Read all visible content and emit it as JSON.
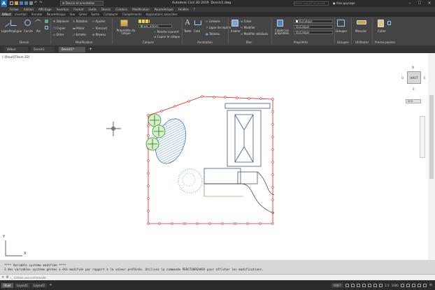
{
  "title": {
    "app": "Autodesk Civil 3D 2019",
    "file": "Dessin1.dwg",
    "workspace": "Dessin et annotation",
    "search_placeholder": "Entrez mot-clé ou phrase",
    "user": "Alex.gaysage"
  },
  "menu": [
    "Fichier",
    "Edition",
    "Affichage",
    "Insertion",
    "Format",
    "Outils",
    "Dessin",
    "Cotation",
    "Modification",
    "Paramétrique",
    "Fenêtre",
    "?"
  ],
  "ribbon_tabs": [
    "Début",
    "Insertion",
    "Annoter",
    "Paramétrique",
    "Vue",
    "Gérer",
    "Sortie",
    "Collaborer",
    "Compléments",
    "Applications associées"
  ],
  "ribbon": {
    "groups": [
      "Dessin",
      "Modification",
      "Calques",
      "Annotation",
      "Bloc",
      "Propriétés",
      "Groupes",
      "Utilitaires",
      "Presse-papiers"
    ],
    "draw_tools": [
      "Ligne",
      "Polyligne",
      "Cercle",
      "Arc"
    ],
    "modify_tools": [
      "Déplacer",
      "Rotation",
      "Ajuster",
      "Copier",
      "Miroir",
      "Raccord",
      "Etirer",
      "Echelle",
      "Réseau"
    ],
    "layer_props": "Propriétés du calque",
    "layer_name": "ww_arbres",
    "make_current": "Rendre courant",
    "match_layer": "Copier le calque",
    "text_tool": "Texte",
    "dim_tool": "Cote",
    "linear": "Linéaire",
    "leader": "Ligne de repère",
    "table": "Tableau",
    "insert_tool": "Insérer",
    "create": "Créer",
    "edit": "Modifier",
    "edit_attr": "Modifier attributs",
    "match_props": "Copier les propriétés",
    "bylayer": "DuCalque",
    "group_tool": "Grouper",
    "measure": "Mesurer",
    "paste": "Coller"
  },
  "doc_tabs": [
    "Début",
    "Dessin1",
    "Dessin1*"
  ],
  "viewport_label": "[-][Haut][Filaire 2D]",
  "viewcube": {
    "face": "HAUT",
    "north": "N",
    "south": "S",
    "west": "O",
    "east": "E",
    "wcs": "SCG"
  },
  "ucs": {
    "x": "X",
    "y": "Y"
  },
  "command_history": [
    "**** Variable système modifiée ****",
    "3 des variables système gérées a été modifiée par rapport à la valeur préférée. Utilisez la commande PERCTOURSAVEV pour afficher les modifications."
  ],
  "command_placeholder": "Entrez une commande",
  "layout_tabs": [
    "Objet",
    "Layout1",
    "Layout2"
  ],
  "status": {
    "mode": "OBJET",
    "scale": "1:1",
    "zoom": "1600"
  }
}
